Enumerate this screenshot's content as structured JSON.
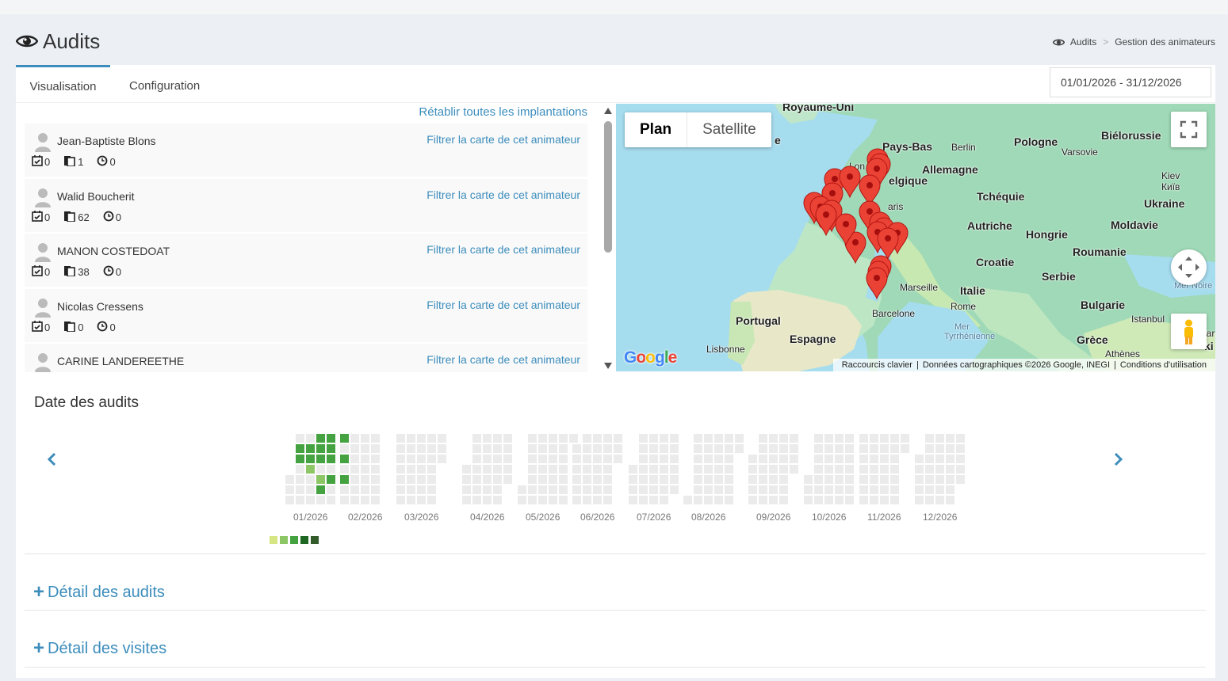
{
  "page": {
    "title": "Audits",
    "breadcrumb": [
      "Audits",
      ">",
      "Gestion des animateurs"
    ]
  },
  "tabs": [
    {
      "label": "Visualisation",
      "active": true
    },
    {
      "label": "Configuration",
      "active": false
    }
  ],
  "date_range": "01/01/2026 - 31/12/2026",
  "animator_list": {
    "reset_link": "Rétablir toutes les implantations",
    "filter_link": "Filtrer la carte de cet animateur",
    "animators": [
      {
        "name": "Jean-Baptiste Blons",
        "audits": "0",
        "docs": "1",
        "visits": "0"
      },
      {
        "name": "Walid Boucherit",
        "audits": "0",
        "docs": "62",
        "visits": "0"
      },
      {
        "name": "MANON COSTEDOAT",
        "audits": "0",
        "docs": "38",
        "visits": "0"
      },
      {
        "name": "Nicolas Cressens",
        "audits": "0",
        "docs": "0",
        "visits": "0"
      },
      {
        "name": "CARINE LANDEREETHE",
        "audits": "",
        "docs": "",
        "visits": ""
      }
    ]
  },
  "map": {
    "type_buttons": [
      "Plan",
      "Satellite"
    ],
    "labels": {
      "uk": "Royaume-Uni",
      "netherlands": "Pays-Bas",
      "berlin": "Berlin",
      "poland": "Pologne",
      "belarus": "Biélorussie",
      "varsovie": "Varsovie",
      "germany": "Allemagne",
      "kiev": "Kiev",
      "kiev_cyr": "Київ",
      "belgium": "elgique",
      "czech": "Tchéquie",
      "ukraine": "Ukraine",
      "paris": "aris",
      "austria": "Autriche",
      "hungary": "Hongrie",
      "moldova": "Moldavie",
      "romania": "Roumanie",
      "croatia": "Croatie",
      "serbia": "Serbie",
      "black_sea": "Mer Noire",
      "marseille": "Marseille",
      "italy": "Italie",
      "rome": "Rome",
      "bulgaria": "Bulgarie",
      "portugal": "Portugal",
      "barcelona": "Barcelone",
      "istanbul": "Istanbul",
      "tyrrhenian": "Mer",
      "tyrrhenian2": "Tyrrhénienne",
      "ankara": "Ankar",
      "spain": "Espagne",
      "lisbon": "Lisbonne",
      "greece": "Grèce",
      "athens": "Athènes",
      "turkey": "ki",
      "france_e": "e",
      "london": "Lon"
    },
    "google": "Google",
    "footer": [
      "Raccourcis clavier",
      "Données cartographiques ©2026 Google, INEGI",
      "Conditions d'utilisation"
    ],
    "marker_count": 22,
    "marker_color": "#ea4335"
  },
  "heatmap": {
    "title": "Date des audits",
    "months": [
      "01/2026",
      "02/2026",
      "03/2026",
      "04/2026",
      "05/2026",
      "06/2026",
      "07/2026",
      "08/2026",
      "09/2026",
      "10/2026",
      "11/2026",
      "12/2026"
    ],
    "empty_color": "#ebebeb",
    "legend_colors": [
      "#d6e685",
      "#8cc665",
      "#44a340",
      "#1e6823",
      "#335c2a"
    ],
    "activity": {
      "01/2026": [
        {
          "week": 0,
          "day": 0,
          "level": 2
        },
        {
          "week": 1,
          "day": 1,
          "level": 2
        },
        {
          "week": 1,
          "day": 2,
          "level": 2
        },
        {
          "week": 2,
          "day": 1,
          "level": 2
        },
        {
          "week": 2,
          "day": 2,
          "level": 2
        },
        {
          "week": 2,
          "day": 3,
          "level": 1
        },
        {
          "week": 3,
          "day": 0,
          "level": 2
        },
        {
          "week": 3,
          "day": 1,
          "level": 2
        },
        {
          "week": 3,
          "day": 2,
          "level": 2
        },
        {
          "week": 3,
          "day": 4,
          "level": 1
        },
        {
          "week": 3,
          "day": 5,
          "level": 2
        },
        {
          "week": 4,
          "day": 0,
          "level": 2
        },
        {
          "week": 4,
          "day": 1,
          "level": 2
        },
        {
          "week": 4,
          "day": 2,
          "level": 2
        },
        {
          "week": 4,
          "day": 4,
          "level": 2
        }
      ],
      "02/2026": [
        {
          "week": 0,
          "day": 0,
          "level": 2
        },
        {
          "week": 0,
          "day": 2,
          "level": 2
        },
        {
          "week": 0,
          "day": 4,
          "level": 2
        }
      ]
    }
  },
  "details": [
    {
      "label": "Détail des audits"
    },
    {
      "label": "Détail des visites"
    }
  ]
}
